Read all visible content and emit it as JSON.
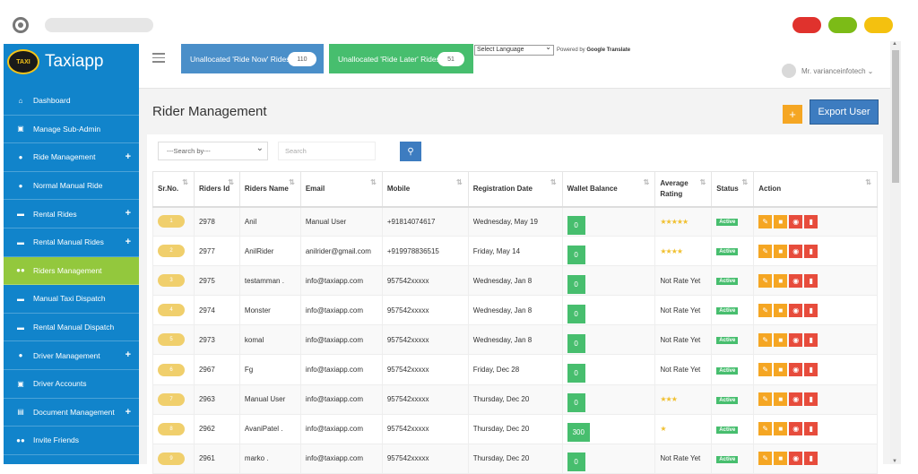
{
  "app": {
    "brand": "Taxiapp",
    "logo_text": "TAXI"
  },
  "sidebar": {
    "items": [
      {
        "label": "Dashboard",
        "icon": "home-icon",
        "plus": false,
        "active": false
      },
      {
        "label": "Manage Sub-Admin",
        "icon": "user-lock-icon",
        "plus": false,
        "active": false
      },
      {
        "label": "Ride Management",
        "icon": "user-icon",
        "plus": true,
        "active": false
      },
      {
        "label": "Normal Manual Ride",
        "icon": "user-icon",
        "plus": false,
        "active": false
      },
      {
        "label": "Rental Rides",
        "icon": "car-icon",
        "plus": true,
        "active": false
      },
      {
        "label": "Rental Manual Rides",
        "icon": "car-icon",
        "plus": true,
        "active": false
      },
      {
        "label": "Riders Management",
        "icon": "users-icon",
        "plus": false,
        "active": true
      },
      {
        "label": "Manual Taxi Dispatch",
        "icon": "taxi-icon",
        "plus": false,
        "active": false
      },
      {
        "label": "Rental Manual Dispatch",
        "icon": "taxi-icon",
        "plus": false,
        "active": false
      },
      {
        "label": "Driver Management",
        "icon": "user-icon",
        "plus": true,
        "active": false
      },
      {
        "label": "Driver Accounts",
        "icon": "money-icon",
        "plus": false,
        "active": false
      },
      {
        "label": "Document Management",
        "icon": "document-icon",
        "plus": true,
        "active": false
      },
      {
        "label": "Invite Friends",
        "icon": "users-icon",
        "plus": false,
        "active": false
      }
    ]
  },
  "header": {
    "unalloc_now": {
      "label": "Unallocated 'Ride Now' Rides",
      "count": "110"
    },
    "unalloc_later": {
      "label": "Unallocated 'Ride Later' Rides",
      "count": "51"
    },
    "language_select": "Select Language",
    "powered_by": "Powered by",
    "google_translate": "Google Translate",
    "user_name": "Mr. varianceinfotech"
  },
  "page": {
    "title": "Rider Management",
    "add_label": "+",
    "export_label": "Export User",
    "search_by": "---Search by---",
    "search_placeholder": "Search"
  },
  "table": {
    "columns": [
      "Sr.No.",
      "Riders Id",
      "Riders Name",
      "Email",
      "Mobile",
      "Registration Date",
      "Wallet Balance",
      "Average Rating",
      "Status",
      "Action"
    ],
    "rows": [
      {
        "sr": "1",
        "id": "2978",
        "name": "Anil",
        "email": "Manual User",
        "mobile": "+91814074617",
        "date": "Wednesday, May 19",
        "wallet": "0",
        "rating": "★★★★★",
        "status": "Active"
      },
      {
        "sr": "2",
        "id": "2977",
        "name": "AnilRider",
        "email": "anilrider@gmail.com",
        "mobile": "+919978836515",
        "date": "Friday, May 14",
        "wallet": "0",
        "rating": "★★★★",
        "status": "Active"
      },
      {
        "sr": "3",
        "id": "2975",
        "name": "testamman .",
        "email": "info@taxiapp.com",
        "mobile": "957542xxxxx",
        "date": "Wednesday, Jan 8",
        "wallet": "0",
        "rating": "Not Rate Yet",
        "status": "Active"
      },
      {
        "sr": "4",
        "id": "2974",
        "name": "Monster",
        "email": "info@taxiapp.com",
        "mobile": "957542xxxxx",
        "date": "Wednesday, Jan 8",
        "wallet": "0",
        "rating": "Not Rate Yet",
        "status": "Active"
      },
      {
        "sr": "5",
        "id": "2973",
        "name": "komal",
        "email": "info@taxiapp.com",
        "mobile": "957542xxxxx",
        "date": "Wednesday, Jan 8",
        "wallet": "0",
        "rating": "Not Rate Yet",
        "status": "Active"
      },
      {
        "sr": "6",
        "id": "2967",
        "name": "Fg",
        "email": "info@taxiapp.com",
        "mobile": "957542xxxxx",
        "date": "Friday, Dec 28",
        "wallet": "0",
        "rating": "Not Rate Yet",
        "status": "Active"
      },
      {
        "sr": "7",
        "id": "2963",
        "name": "Manual User",
        "email": "info@taxiapp.com",
        "mobile": "957542xxxxx",
        "date": "Thursday, Dec 20",
        "wallet": "0",
        "rating": "★★★",
        "status": "Active"
      },
      {
        "sr": "8",
        "id": "2962",
        "name": "AvaniPatel .",
        "email": "info@taxiapp.com",
        "mobile": "957542xxxxx",
        "date": "Thursday, Dec 20",
        "wallet": "300",
        "rating": "★",
        "status": "Active"
      },
      {
        "sr": "9",
        "id": "2961",
        "name": "marko .",
        "email": "info@taxiapp.com",
        "mobile": "957542xxxxx",
        "date": "Thursday, Dec 20",
        "wallet": "0",
        "rating": "Not Rate Yet",
        "status": "Active"
      }
    ]
  },
  "colors": {
    "sidebar": "#1184cb",
    "active": "#93c83d",
    "primary": "#3d7cc0",
    "success": "#47be6e",
    "warning": "#f5a623",
    "danger": "#e74c3c"
  }
}
